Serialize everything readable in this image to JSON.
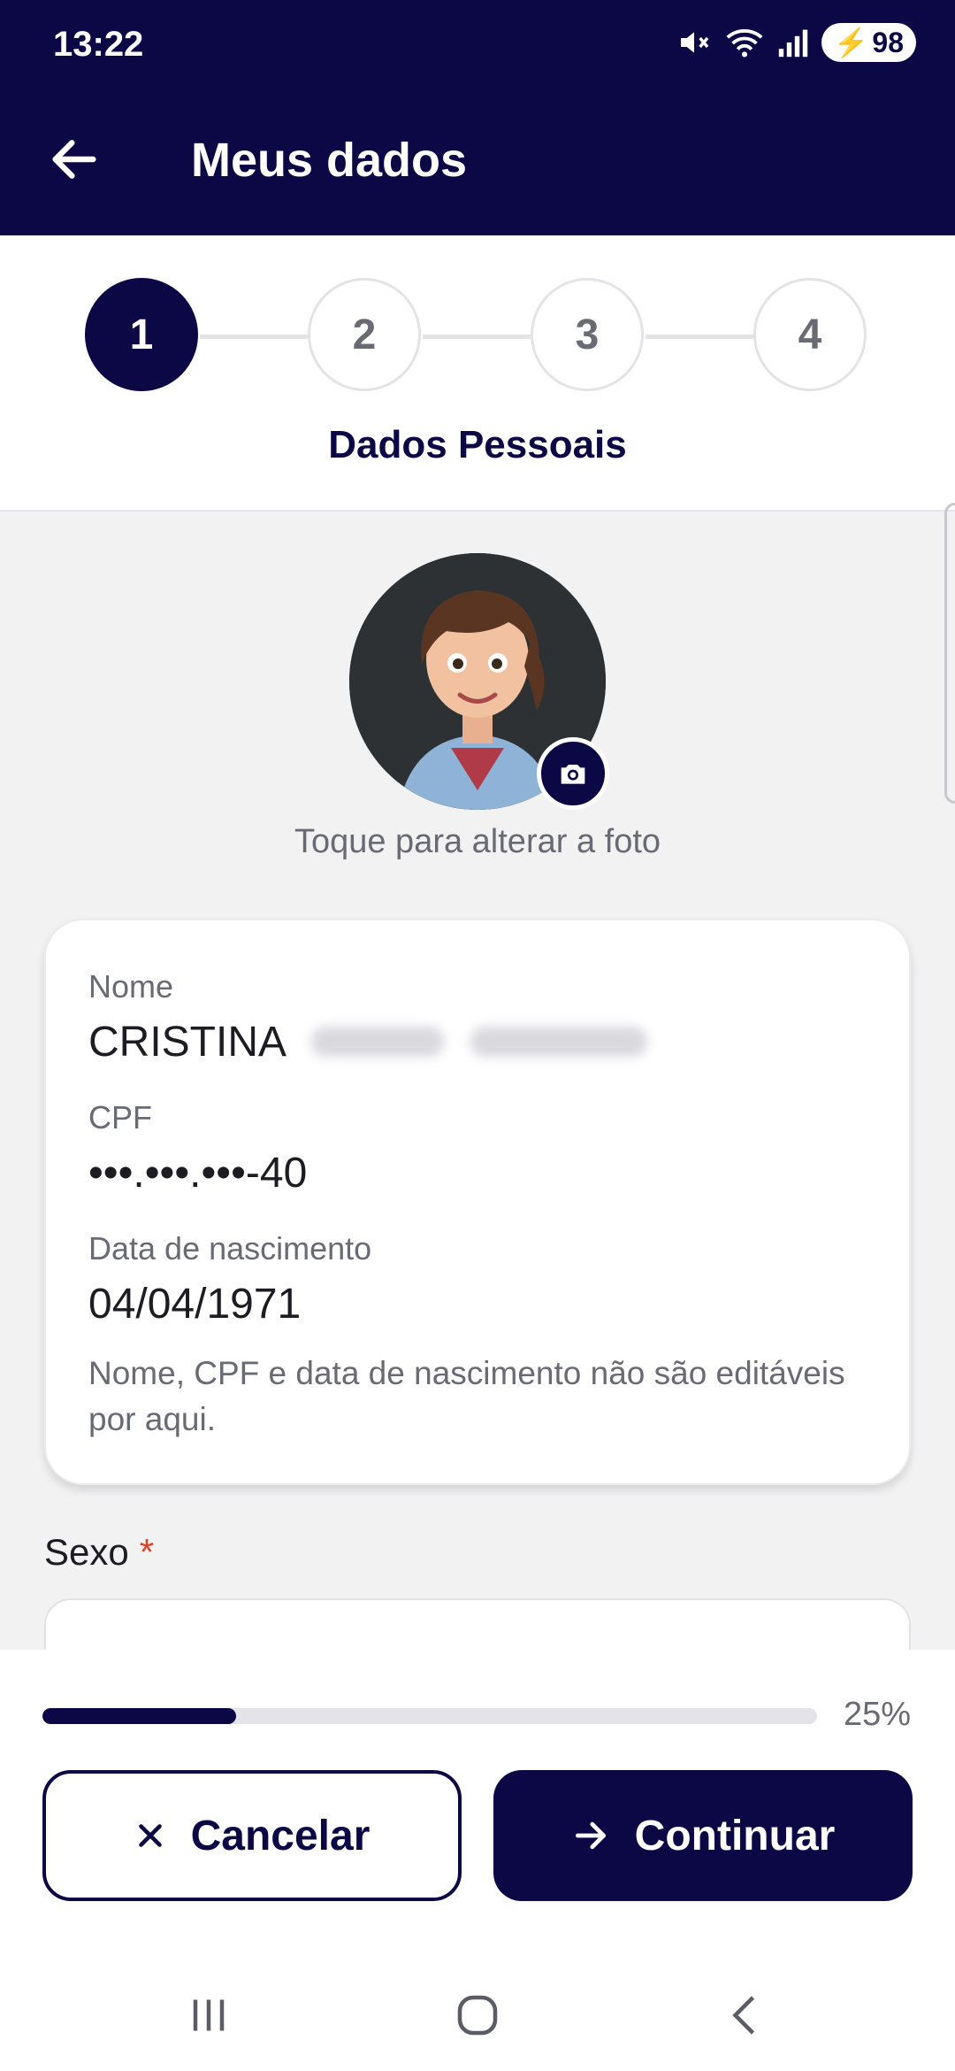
{
  "status_bar": {
    "time": "13:22",
    "battery": "98"
  },
  "header": {
    "title": "Meus dados"
  },
  "stepper": {
    "steps": [
      "1",
      "2",
      "3",
      "4"
    ],
    "active_step": 1,
    "current_label": "Dados Pessoais"
  },
  "profile": {
    "photo_hint": "Toque para alterar a foto"
  },
  "info_card": {
    "name_label": "Nome",
    "name_value": "CRISTINA",
    "cpf_label": "CPF",
    "cpf_value": "•••.•••.•••-40",
    "birth_label": "Data de nascimento",
    "birth_value": "04/04/1971",
    "note": "Nome, CPF e data de nascimento não são editáveis por aqui."
  },
  "form": {
    "sexo_label": "Sexo",
    "required_mark": "*"
  },
  "progress": {
    "percent": 25,
    "label": "25%"
  },
  "actions": {
    "cancel_label": "Cancelar",
    "continue_label": "Continuar"
  },
  "colors": {
    "primary": "#0c0846",
    "required": "#e4412a",
    "background": "#f2f2f3"
  }
}
